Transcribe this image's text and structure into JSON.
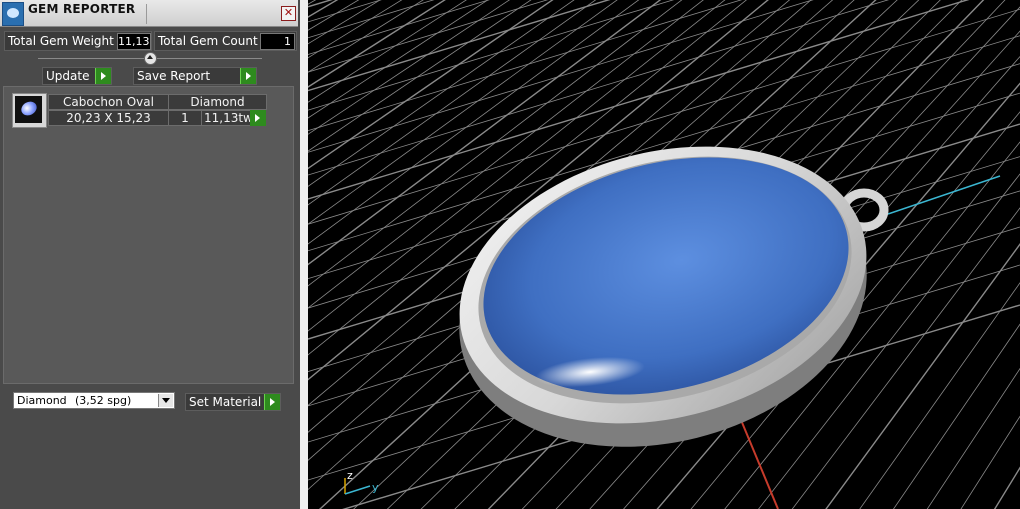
{
  "window": {
    "title": "GEM REPORTER",
    "close_glyph": "✕"
  },
  "stats": {
    "total_weight": {
      "label": "Total Gem Weight",
      "value": "11,13"
    },
    "total_count": {
      "label": "Total Gem Count",
      "value": "1"
    }
  },
  "actions": {
    "update": "Update",
    "save_report": "Save Report"
  },
  "gem_list": {
    "headers": [
      "Cabochon Oval",
      "Diamond"
    ],
    "rows": [
      {
        "icon": "oval-gem-icon",
        "dimensions": "20,23 X 15,23",
        "count": "1",
        "weight": "11,13tw"
      }
    ]
  },
  "material": {
    "select_name": "Diamond",
    "select_spg": "(3,52 spg)",
    "set_label": "Set Material"
  },
  "viewport": {
    "axes": {
      "z": "z",
      "y": "y"
    },
    "colors": {
      "gem": "#3f6fc2",
      "metal": "#e6e6e6",
      "grid": "#8a8a8a",
      "axis_y": "#3bb6d1",
      "axis_x": "#c63b2b",
      "axis_z": "#d9a400"
    }
  }
}
